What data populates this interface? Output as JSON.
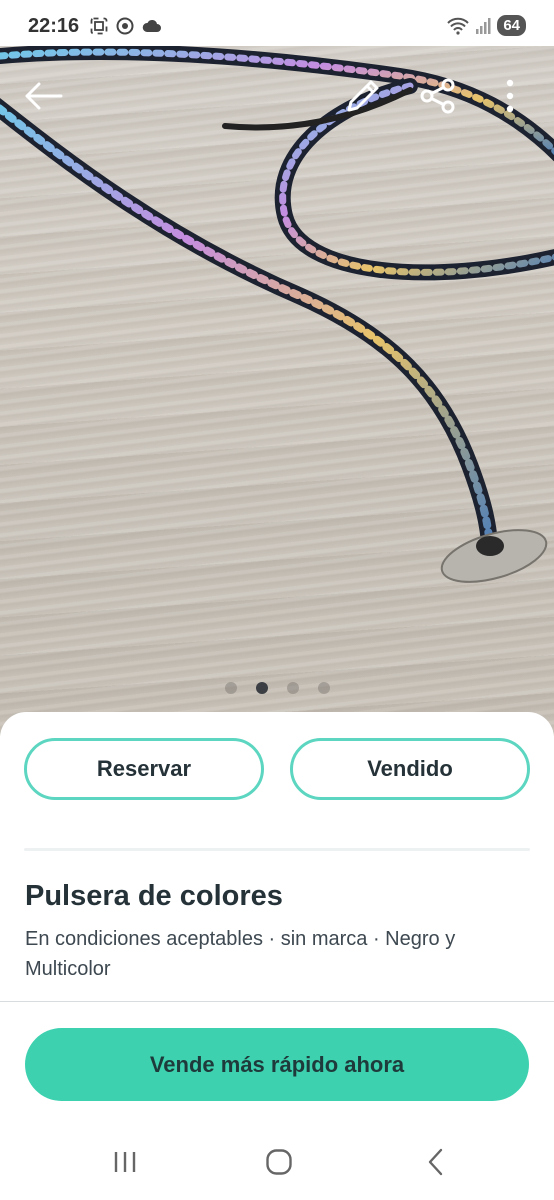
{
  "status_bar": {
    "time": "22:16",
    "battery": "64",
    "left_icons": [
      "screenshot-icon",
      "chrome-icon",
      "cloud-icon"
    ],
    "right_icons": [
      "wifi-icon",
      "signal-icon",
      "battery-icon"
    ]
  },
  "photo": {
    "toolbar": [
      "back-arrow-icon",
      "edit-pencil-icon",
      "share-icon",
      "more-vertical-icon"
    ],
    "pager": {
      "total": 4,
      "active_index": 1
    }
  },
  "actions": {
    "reserve_label": "Reservar",
    "sold_label": "Vendido"
  },
  "listing": {
    "title": "Pulsera de colores",
    "details": "En condiciones aceptables · sin marca · Negro y Multicolor"
  },
  "promo": {
    "button_label": "Vende más rápido ahora"
  },
  "colors": {
    "accent": "#3dd1b0",
    "accent_outline": "#5cd6c0",
    "text": "#253238"
  },
  "nav_bar": [
    "recents-icon",
    "home-icon",
    "back-icon"
  ]
}
